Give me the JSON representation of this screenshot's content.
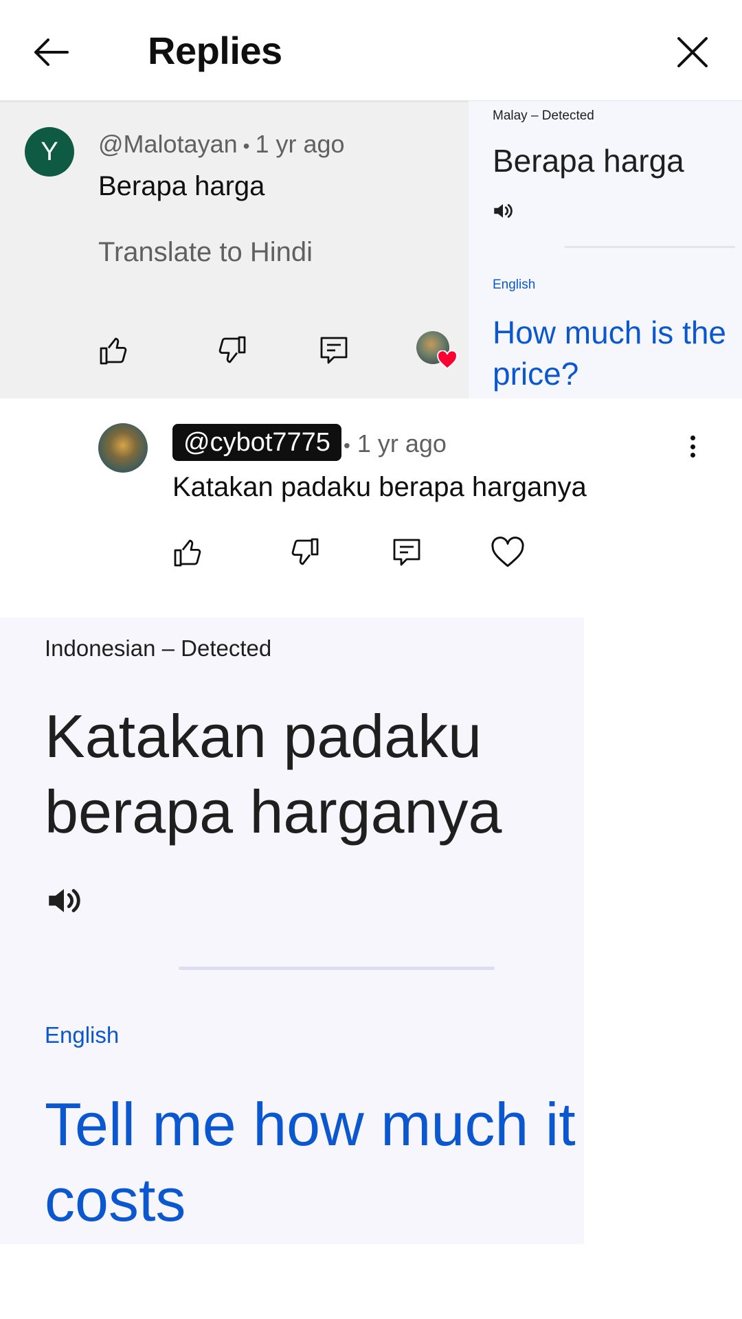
{
  "header": {
    "title": "Replies"
  },
  "parent_comment": {
    "avatar_letter": "Y",
    "author": "@Malotayan",
    "time": "1 yr ago",
    "text": "Berapa harga",
    "translate_label": "Translate to Hindi"
  },
  "translation_panel_1": {
    "source_label": "Malay – Detected",
    "source_text": "Berapa harga",
    "target_label": "English",
    "target_text": "How much is the price?"
  },
  "reply": {
    "author": "@cybot7775",
    "time": "1 yr ago",
    "text": "Katakan padaku berapa harganya"
  },
  "translation_panel_2": {
    "source_label": "Indonesian – Detected",
    "source_text": "Katakan padaku berapa harganya",
    "target_label": "English",
    "target_text": "Tell me how much it costs"
  },
  "colors": {
    "avatar_y": "#0f5a43",
    "translation_blue": "#0b57d0",
    "heart_red": "#ff0033",
    "comment_bg": "#f0f0f0",
    "card_bg": "#f6f6fc"
  }
}
